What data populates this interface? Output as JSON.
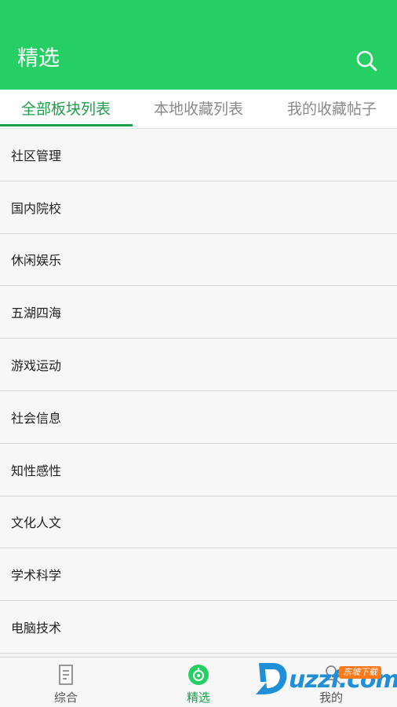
{
  "header": {
    "title": "精选",
    "search_icon": "search-icon",
    "background_color": "#26cf63"
  },
  "tabs": [
    {
      "label": "全部板块列表",
      "active": true
    },
    {
      "label": "本地收藏列表",
      "active": false
    },
    {
      "label": "我的收藏帖子",
      "active": false
    }
  ],
  "boards": [
    {
      "label": "社区管理"
    },
    {
      "label": "国内院校"
    },
    {
      "label": "休闲娱乐"
    },
    {
      "label": "五湖四海"
    },
    {
      "label": "游戏运动"
    },
    {
      "label": "社会信息"
    },
    {
      "label": "知性感性"
    },
    {
      "label": "文化人文"
    },
    {
      "label": "学术科学"
    },
    {
      "label": "电脑技术"
    }
  ],
  "bottom_nav": [
    {
      "label": "综合",
      "icon": "document-icon",
      "active": false
    },
    {
      "label": "精选",
      "icon": "compass-icon",
      "active": true
    },
    {
      "label": "我的",
      "icon": "person-icon",
      "active": false
    }
  ],
  "watermark": {
    "text": "uzzf.com",
    "badge": "东坡下载"
  },
  "colors": {
    "accent": "#1a9e47",
    "header": "#26cf63"
  }
}
